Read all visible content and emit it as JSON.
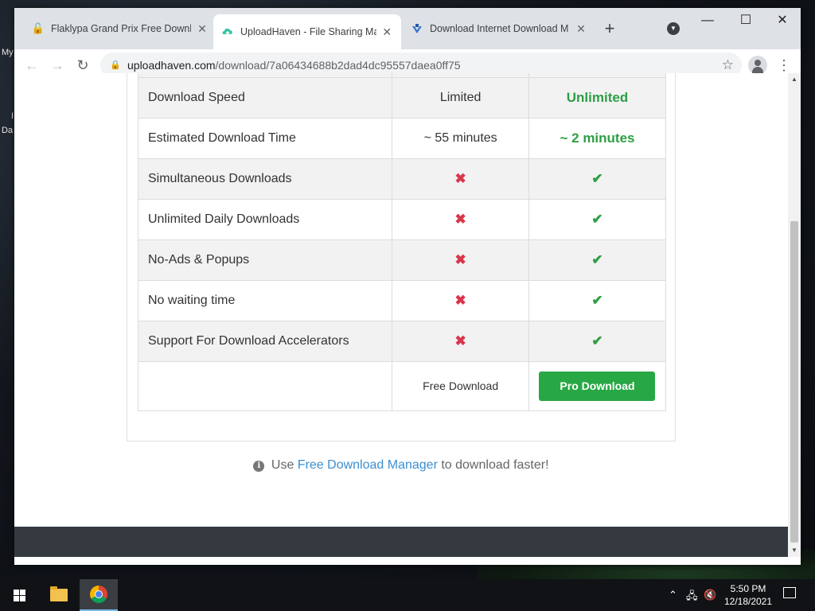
{
  "desktop": {
    "label_1": "My",
    "label_2": "I",
    "label_3": "Da"
  },
  "browser": {
    "tabs": [
      {
        "title": "Flaklypa Grand Prix Free Downlo",
        "close": "✕",
        "icon": "lock-icon"
      },
      {
        "title": "UploadHaven - File Sharing Mad",
        "close": "✕",
        "icon": "uploadhaven-icon"
      },
      {
        "title": "Download Internet Download M",
        "close": "✕",
        "icon": "idm-icon"
      }
    ],
    "new_tab": "+",
    "url_host": "uploadhaven.com",
    "url_path": "/download/7a06434688b2dad4dc95557daea0ff75",
    "window_controls": {
      "minimize": "—",
      "maximize": "☐",
      "close": "✕"
    }
  },
  "comparison": {
    "rows": [
      {
        "feature": "Download Speed",
        "free": "Limited",
        "pro": "Unlimited",
        "type": "text"
      },
      {
        "feature": "Estimated Download Time",
        "free": "~ 55 minutes",
        "pro": "~ 2 minutes",
        "type": "text"
      },
      {
        "feature": "Simultaneous Downloads",
        "free": "✖",
        "pro": "✔",
        "type": "icon"
      },
      {
        "feature": "Unlimited Daily Downloads",
        "free": "✖",
        "pro": "✔",
        "type": "icon"
      },
      {
        "feature": "No-Ads & Popups",
        "free": "✖",
        "pro": "✔",
        "type": "icon"
      },
      {
        "feature": "No waiting time",
        "free": "✖",
        "pro": "✔",
        "type": "icon"
      },
      {
        "feature": "Support For Download Accelerators",
        "free": "✖",
        "pro": "✔",
        "type": "icon"
      }
    ],
    "free_download_label": "Free Download",
    "pro_download_label": "Pro Download"
  },
  "tip": {
    "prefix": "Use",
    "link": "Free Download Manager",
    "suffix": "to download faster!"
  },
  "taskbar": {
    "time": "5:50 PM",
    "date": "12/18/2021"
  },
  "colors": {
    "pro_green": "#2e9e44",
    "cross_red": "#d9364a",
    "button_green": "#28a745",
    "link_blue": "#3b8fd0",
    "footer_dark": "#343a40"
  }
}
